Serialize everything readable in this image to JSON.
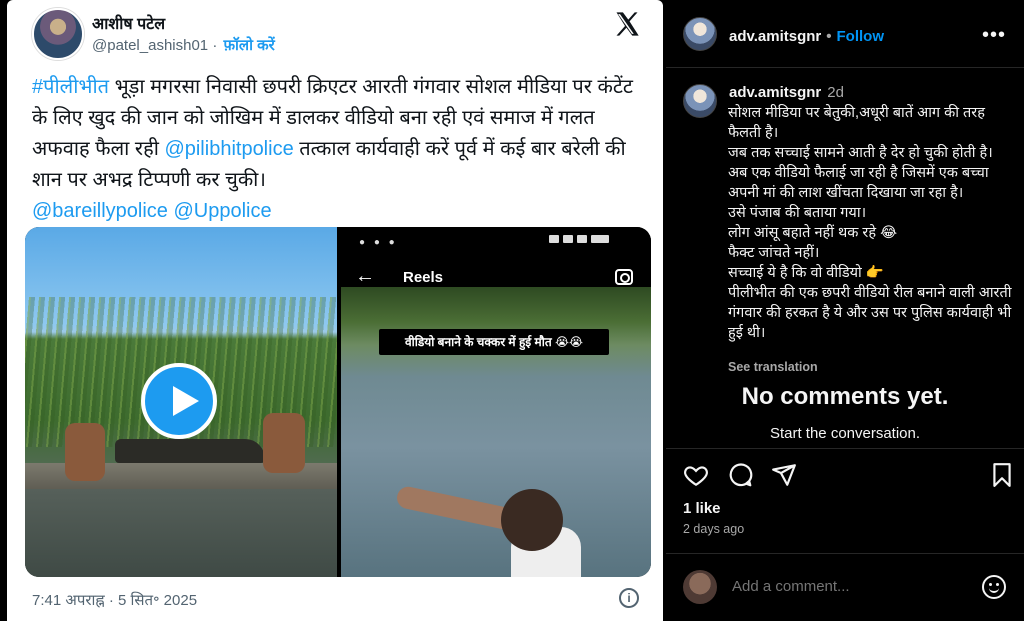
{
  "tweet": {
    "author_name": "आशीष पटेल",
    "handle": "@patel_ashish01",
    "separator": "·",
    "follow_label": "फ़ॉलो करें",
    "text_parts": [
      {
        "text": "#पीलीभीत",
        "link": true
      },
      {
        "text": " भूड़ा मगरसा निवासी छपरी क्रिएटर आरती गंगवार सोशल मीडिया पर कंटेंट के लिए खुद की जान को जोखिम में डालकर वीडियो बना रही एवं समाज में गलत अफवाह फैला रही ",
        "link": false
      },
      {
        "text": "@pilibhitpolice",
        "link": true
      },
      {
        "text": " तत्काल कार्यवाही करें पूर्व में कई बार बरेली की शान पर अभद्र टिप्पणी कर चुकी।",
        "link": false
      },
      {
        "text": "\n",
        "link": false
      },
      {
        "text": "@bareillypolice",
        "link": true
      },
      {
        "text": " ",
        "link": false
      },
      {
        "text": "@Uppolice",
        "link": true
      }
    ],
    "reels_label": "Reels",
    "video_caption": "वीडियो बनाने के चक्कर में हुई मौत 😭😭",
    "timestamp": "7:41 अपराह्न · 5 सित॰ 2025",
    "icons": {
      "brand": "x-logo-icon",
      "play": "play-icon",
      "info": "info-icon"
    }
  },
  "instagram": {
    "username": "adv.amitsgnr",
    "follow_label": "Follow",
    "separator": "•",
    "more_label": "•••",
    "post_time": "2d",
    "caption_lines": [
      "सोशल मीडिया पर बेतुकी,अधूरी बातें आग की तरह फैलती है।",
      "जब तक सच्चाई सामने आती है देर हो चुकी होती है।",
      "अब एक वीडियो फैलाई जा रही है जिसमें एक बच्चा अपनी मां की लाश खींचता दिखाया जा रहा है।",
      "उसे पंजाब की बताया गया।",
      "लोग आंसू बहाते नहीं थक रहे 😂",
      "फैक्ट जांचते नहीं।",
      "सच्चाई ये है कि वो वीडियो 👉",
      "पीलीभीत की एक छपरी वीडियो रील बनाने वाली आरती गंगवार की हरकत है ये और उस पर पुलिस कार्यवाही भी हुई थी।"
    ],
    "see_translation": "See translation",
    "empty_title": "No comments yet.",
    "empty_subtitle": "Start the conversation.",
    "likes": "1 like",
    "posted_ago": "2 days ago",
    "comment_placeholder": "Add a comment...",
    "icons": [
      "heart-icon",
      "comment-icon",
      "share-icon",
      "bookmark-icon",
      "emoji-icon",
      "more-icon"
    ]
  }
}
